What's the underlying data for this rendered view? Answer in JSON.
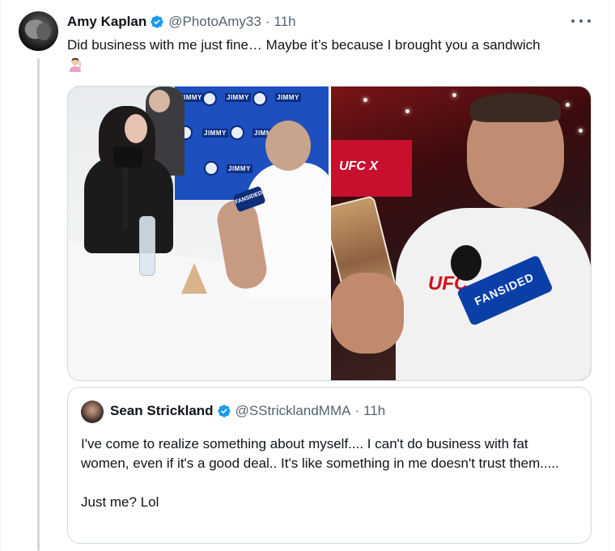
{
  "tweet": {
    "author_name": "Amy Kaplan",
    "handle": "@PhotoAmy33",
    "separator": "·",
    "time": "11h",
    "text": "Did business with me just fine… Maybe it’s because I brought you a sandwich",
    "emoji": "person-raising-hand-emoji",
    "verified_color": "#1d9bf0"
  },
  "media": {
    "left_photo": {
      "backdrop_label": "JIMMY",
      "mic_label": "FANSIDED"
    },
    "right_photo": {
      "banner_label": "UFC X",
      "shirt_label": "UFC",
      "mic_label": "FANSIDED"
    }
  },
  "quoted_tweet": {
    "author_name": "Sean Strickland",
    "handle": "@SStricklandMMA",
    "separator": "·",
    "time": "11h",
    "paragraph_1": "I've come to realize something about myself.... I can't do business with fat women, even if it's a good deal.. It's like something in me doesn't trust them.....",
    "paragraph_2": "Just me? Lol"
  },
  "colors": {
    "text": "#0f1419",
    "muted": "#536471",
    "border": "#cfd9de",
    "verified": "#1d9bf0"
  }
}
